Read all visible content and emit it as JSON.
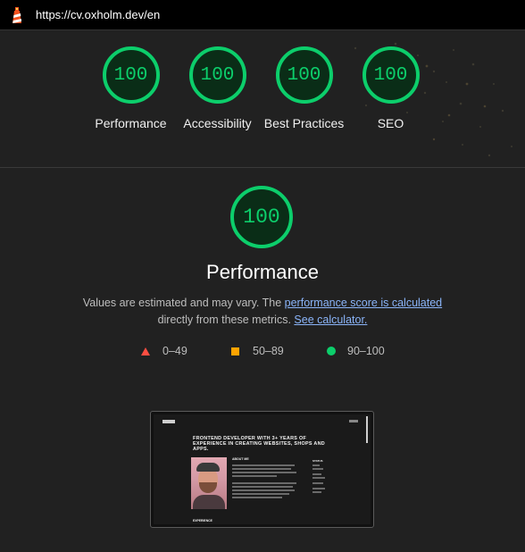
{
  "topbar": {
    "url": "https://cv.oxholm.dev/en",
    "logo_icon": "lighthouse-icon"
  },
  "colors": {
    "pass": "#0cce6b",
    "average": "#ffa400",
    "fail": "#ff4e42",
    "link": "#8ab4f8",
    "background": "#212121"
  },
  "summary": {
    "categories": [
      {
        "score": "100",
        "label": "Performance"
      },
      {
        "score": "100",
        "label": "Accessibility"
      },
      {
        "score": "100",
        "label": "Best Practices"
      },
      {
        "score": "100",
        "label": "SEO"
      }
    ]
  },
  "performance": {
    "score": "100",
    "title": "Performance",
    "desc_part1": "Values are estimated and may vary. The ",
    "desc_link1": "performance score is calculated",
    "desc_part2": " directly from these metrics. ",
    "desc_link2": "See calculator.",
    "legend": {
      "fail": "0–49",
      "average": "50–89",
      "pass": "90–100"
    }
  },
  "screenshot": {
    "headline": "FRONTEND DEVELOPER WITH 3+ YEARS OF EXPERIENCE IN CREATING WEBSITES, SHOPS AND APPS.",
    "about": "ABOUT ME",
    "status": "STATUS",
    "experience": "EXPERIENCE"
  }
}
